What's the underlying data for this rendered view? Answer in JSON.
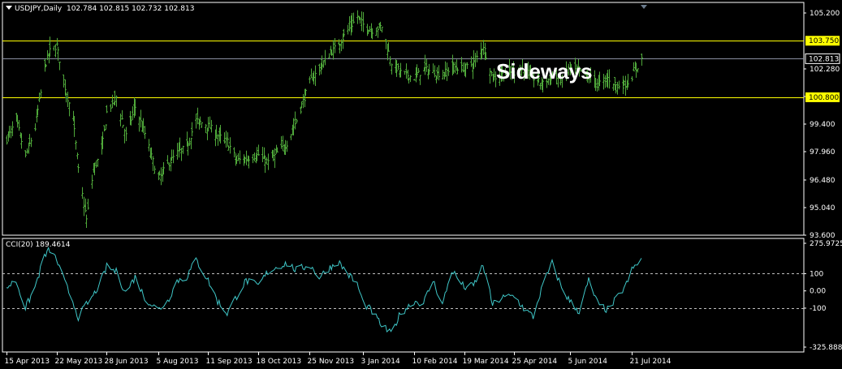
{
  "header": {
    "symbol": "USDJPY,Daily",
    "ohlc": "102.784 102.815 102.732 102.813"
  },
  "annotation": "Sideways",
  "colors": {
    "background": "#000000",
    "grid_frame": "#ffffff",
    "bars": "#4fa83a",
    "cci_line": "#3fc7c8",
    "level_line": "#ffff00",
    "price_line": "#8a8fa0",
    "tag_bg": "#ffff00"
  },
  "chart_data": [
    {
      "type": "ohlc",
      "symbol": "USDJPY",
      "timeframe": "Daily",
      "x_ticks": [
        "15 Apr 2013",
        "22 May 2013",
        "28 Jun 2013",
        "5 Aug 2013",
        "11 Sep 2013",
        "18 Oct 2013",
        "25 Nov 2013",
        "3 Jan 2014",
        "10 Feb 2014",
        "19 Mar 2014",
        "25 Apr 2014",
        "5 Jun 2014",
        "21 Jul 2014"
      ],
      "y_ticks": [
        "105.200",
        "102.280",
        "100.840",
        "99.400",
        "97.960",
        "96.480",
        "95.040",
        "93.600"
      ],
      "ylim": [
        93.6,
        105.75
      ],
      "horizontal_levels": [
        {
          "value": 103.75,
          "label": "103.750"
        },
        {
          "value": 100.8,
          "label": "100.800"
        }
      ],
      "current_price": {
        "value": 102.813,
        "label": "102.813"
      },
      "close_series": [
        {
          "x": "15 Apr 2013",
          "y": 98.6
        },
        {
          "x": "22 Apr 2013",
          "y": 99.6
        },
        {
          "x": "29 Apr 2013",
          "y": 97.7
        },
        {
          "x": "6 May 2013",
          "y": 99.2
        },
        {
          "x": "13 May 2013",
          "y": 102.4
        },
        {
          "x": "17 May 2013",
          "y": 103.2
        },
        {
          "x": "22 May 2013",
          "y": 103.5
        },
        {
          "x": "28 May 2013",
          "y": 101.3
        },
        {
          "x": "3 Jun 2013",
          "y": 99.7
        },
        {
          "x": "7 Jun 2013",
          "y": 97.0
        },
        {
          "x": "13 Jun 2013",
          "y": 94.4
        },
        {
          "x": "18 Jun 2013",
          "y": 97.0
        },
        {
          "x": "24 Jun 2013",
          "y": 98.0
        },
        {
          "x": "28 Jun 2013",
          "y": 100.0
        },
        {
          "x": "5 Jul 2013",
          "y": 100.8
        },
        {
          "x": "12 Jul 2013",
          "y": 98.8
        },
        {
          "x": "19 Jul 2013",
          "y": 100.3
        },
        {
          "x": "26 Jul 2013",
          "y": 98.9
        },
        {
          "x": "5 Aug 2013",
          "y": 96.5
        },
        {
          "x": "12 Aug 2013",
          "y": 97.3
        },
        {
          "x": "19 Aug 2013",
          "y": 97.9
        },
        {
          "x": "26 Aug 2013",
          "y": 98.2
        },
        {
          "x": "2 Sep 2013",
          "y": 99.6
        },
        {
          "x": "11 Sep 2013",
          "y": 99.3
        },
        {
          "x": "18 Sep 2013",
          "y": 98.8
        },
        {
          "x": "25 Sep 2013",
          "y": 98.5
        },
        {
          "x": "2 Oct 2013",
          "y": 97.5
        },
        {
          "x": "9 Oct 2013",
          "y": 97.6
        },
        {
          "x": "18 Oct 2013",
          "y": 97.8
        },
        {
          "x": "25 Oct 2013",
          "y": 97.4
        },
        {
          "x": "1 Nov 2013",
          "y": 97.9
        },
        {
          "x": "8 Nov 2013",
          "y": 98.4
        },
        {
          "x": "15 Nov 2013",
          "y": 99.6
        },
        {
          "x": "25 Nov 2013",
          "y": 101.6
        },
        {
          "x": "2 Dec 2013",
          "y": 102.3
        },
        {
          "x": "9 Dec 2013",
          "y": 103.0
        },
        {
          "x": "16 Dec 2013",
          "y": 103.6
        },
        {
          "x": "23 Dec 2013",
          "y": 104.3
        },
        {
          "x": "30 Dec 2013",
          "y": 105.0
        },
        {
          "x": "3 Jan 2014",
          "y": 104.6
        },
        {
          "x": "10 Jan 2014",
          "y": 104.3
        },
        {
          "x": "17 Jan 2014",
          "y": 104.5
        },
        {
          "x": "24 Jan 2014",
          "y": 102.6
        },
        {
          "x": "31 Jan 2014",
          "y": 102.1
        },
        {
          "x": "10 Feb 2014",
          "y": 101.8
        },
        {
          "x": "17 Feb 2014",
          "y": 102.3
        },
        {
          "x": "24 Feb 2014",
          "y": 102.1
        },
        {
          "x": "3 Mar 2014",
          "y": 102.0
        },
        {
          "x": "10 Mar 2014",
          "y": 102.4
        },
        {
          "x": "19 Mar 2014",
          "y": 102.3
        },
        {
          "x": "26 Mar 2014",
          "y": 102.6
        },
        {
          "x": "2 Apr 2014",
          "y": 103.5
        },
        {
          "x": "9 Apr 2014",
          "y": 101.8
        },
        {
          "x": "16 Apr 2014",
          "y": 102.0
        },
        {
          "x": "25 Apr 2014",
          "y": 102.1
        },
        {
          "x": "2 May 2014",
          "y": 102.3
        },
        {
          "x": "9 May 2014",
          "y": 101.8
        },
        {
          "x": "16 May 2014",
          "y": 101.5
        },
        {
          "x": "23 May 2014",
          "y": 101.9
        },
        {
          "x": "30 May 2014",
          "y": 101.7
        },
        {
          "x": "5 Jun 2014",
          "y": 102.3
        },
        {
          "x": "12 Jun 2014",
          "y": 102.1
        },
        {
          "x": "19 Jun 2014",
          "y": 101.9
        },
        {
          "x": "26 Jun 2014",
          "y": 101.5
        },
        {
          "x": "3 Jul 2014",
          "y": 101.8
        },
        {
          "x": "10 Jul 2014",
          "y": 101.4
        },
        {
          "x": "17 Jul 2014",
          "y": 101.5
        },
        {
          "x": "21 Jul 2014",
          "y": 101.9
        },
        {
          "x": "28 Jul 2014",
          "y": 102.8
        }
      ]
    },
    {
      "type": "line",
      "title": "CCI(20) 189.4614",
      "y_ticks": [
        "275.9725",
        "100",
        "0.00",
        "-100",
        "-325.888"
      ],
      "ylim": [
        -325.888,
        275.9725
      ],
      "reference_levels": [
        100,
        -100
      ],
      "series": [
        {
          "values": [
            {
              "x": "15 Apr 2013",
              "y": 20
            },
            {
              "x": "22 Apr 2013",
              "y": 60
            },
            {
              "x": "29 Apr 2013",
              "y": -100
            },
            {
              "x": "6 May 2013",
              "y": 20
            },
            {
              "x": "13 May 2013",
              "y": 200
            },
            {
              "x": "17 May 2013",
              "y": 240
            },
            {
              "x": "22 May 2013",
              "y": 180
            },
            {
              "x": "28 May 2013",
              "y": 50
            },
            {
              "x": "3 Jun 2013",
              "y": -60
            },
            {
              "x": "7 Jun 2013",
              "y": -150
            },
            {
              "x": "13 Jun 2013",
              "y": -80
            },
            {
              "x": "18 Jun 2013",
              "y": -30
            },
            {
              "x": "24 Jun 2013",
              "y": 60
            },
            {
              "x": "28 Jun 2013",
              "y": 140
            },
            {
              "x": "5 Jul 2013",
              "y": 110
            },
            {
              "x": "12 Jul 2013",
              "y": -10
            },
            {
              "x": "19 Jul 2013",
              "y": 80
            },
            {
              "x": "26 Jul 2013",
              "y": -40
            },
            {
              "x": "5 Aug 2013",
              "y": -110
            },
            {
              "x": "12 Aug 2013",
              "y": -60
            },
            {
              "x": "19 Aug 2013",
              "y": 60
            },
            {
              "x": "26 Aug 2013",
              "y": 80
            },
            {
              "x": "2 Sep 2013",
              "y": 180
            },
            {
              "x": "11 Sep 2013",
              "y": 60
            },
            {
              "x": "18 Sep 2013",
              "y": -60
            },
            {
              "x": "25 Sep 2013",
              "y": -130
            },
            {
              "x": "2 Oct 2013",
              "y": -30
            },
            {
              "x": "9 Oct 2013",
              "y": 60
            },
            {
              "x": "18 Oct 2013",
              "y": 30
            },
            {
              "x": "25 Oct 2013",
              "y": 110
            },
            {
              "x": "1 Nov 2013",
              "y": 140
            },
            {
              "x": "8 Nov 2013",
              "y": 160
            },
            {
              "x": "15 Nov 2013",
              "y": 120
            },
            {
              "x": "25 Nov 2013",
              "y": 150
            },
            {
              "x": "2 Dec 2013",
              "y": 80
            },
            {
              "x": "9 Dec 2013",
              "y": 130
            },
            {
              "x": "16 Dec 2013",
              "y": 170
            },
            {
              "x": "23 Dec 2013",
              "y": 100
            },
            {
              "x": "30 Dec 2013",
              "y": 40
            },
            {
              "x": "3 Jan 2014",
              "y": -60
            },
            {
              "x": "10 Jan 2014",
              "y": -120
            },
            {
              "x": "17 Jan 2014",
              "y": -200
            },
            {
              "x": "24 Jan 2014",
              "y": -250
            },
            {
              "x": "31 Jan 2014",
              "y": -130
            },
            {
              "x": "10 Feb 2014",
              "y": -60
            },
            {
              "x": "17 Feb 2014",
              "y": -70
            },
            {
              "x": "24 Feb 2014",
              "y": 60
            },
            {
              "x": "3 Mar 2014",
              "y": -80
            },
            {
              "x": "10 Mar 2014",
              "y": 120
            },
            {
              "x": "19 Mar 2014",
              "y": 20
            },
            {
              "x": "26 Mar 2014",
              "y": 30
            },
            {
              "x": "2 Apr 2014",
              "y": 150
            },
            {
              "x": "9 Apr 2014",
              "y": -80
            },
            {
              "x": "16 Apr 2014",
              "y": -40
            },
            {
              "x": "25 Apr 2014",
              "y": -30
            },
            {
              "x": "2 May 2014",
              "y": -100
            },
            {
              "x": "9 May 2014",
              "y": -150
            },
            {
              "x": "16 May 2014",
              "y": 30
            },
            {
              "x": "23 May 2014",
              "y": 160
            },
            {
              "x": "30 May 2014",
              "y": 20
            },
            {
              "x": "5 Jun 2014",
              "y": -60
            },
            {
              "x": "12 Jun 2014",
              "y": -120
            },
            {
              "x": "19 Jun 2014",
              "y": 60
            },
            {
              "x": "26 Jun 2014",
              "y": -80
            },
            {
              "x": "3 Jul 2014",
              "y": -110
            },
            {
              "x": "10 Jul 2014",
              "y": -40
            },
            {
              "x": "17 Jul 2014",
              "y": 40
            },
            {
              "x": "21 Jul 2014",
              "y": 120
            },
            {
              "x": "28 Jul 2014",
              "y": 189.4614
            }
          ]
        }
      ]
    }
  ]
}
